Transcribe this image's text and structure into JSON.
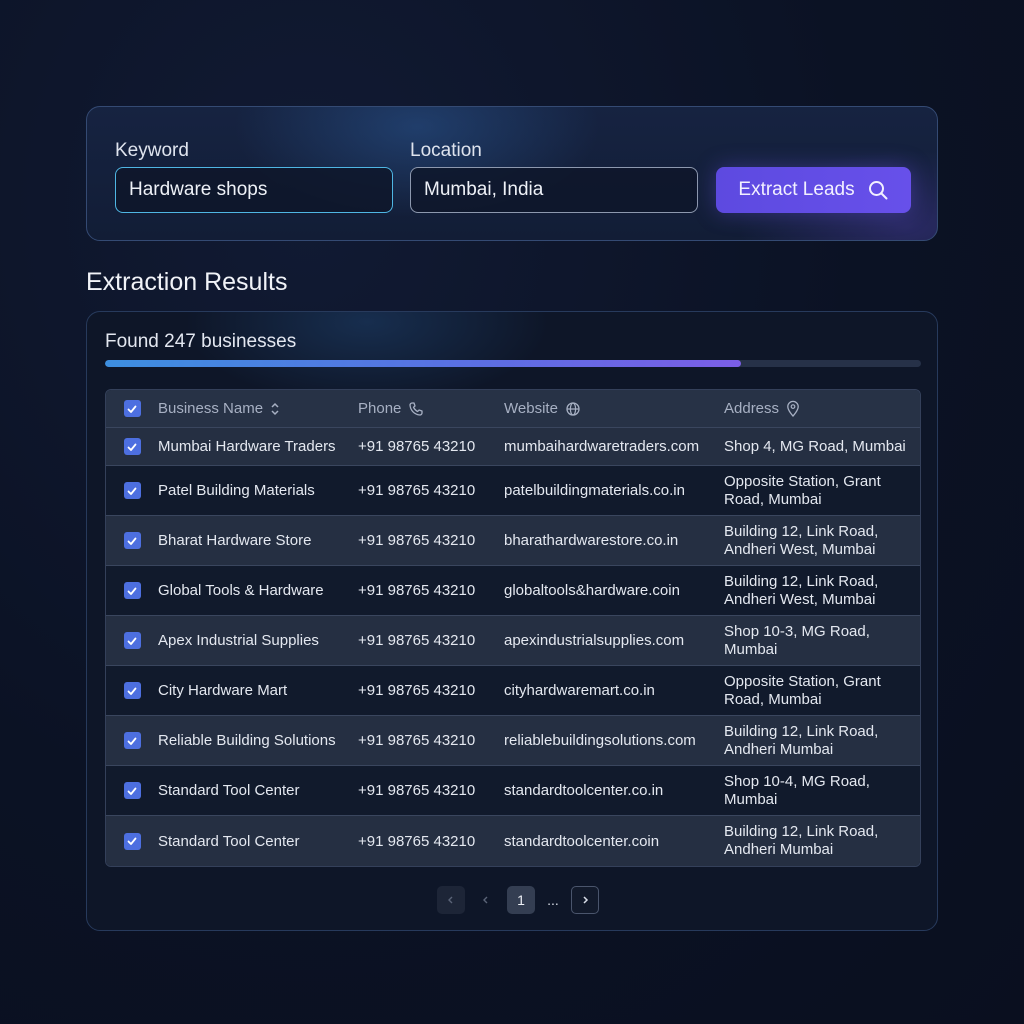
{
  "search": {
    "keyword_label": "Keyword",
    "keyword_value": "Hardware shops",
    "location_label": "Location",
    "location_value": "Mumbai, India",
    "extract_label": "Extract Leads",
    "extract_icon": "search-icon"
  },
  "results": {
    "title": "Extraction Results",
    "found_text": "Found 247 businesses",
    "progress_fraction": 0.78,
    "columns": {
      "name": "Business Name",
      "phone": "Phone",
      "website": "Website",
      "address": "Address"
    },
    "column_icons": {
      "name": "sort-icon",
      "phone": "phone-icon",
      "website": "globe-icon",
      "address": "map-pin-icon"
    },
    "rows": [
      {
        "name": "Mumbai Hardware Traders",
        "phone": "+91 98765 43210",
        "website": "mumbaihardwaretraders.com",
        "address_line1": "Shop 4, MG Road, Mumbai",
        "address_line2": "",
        "checked": true
      },
      {
        "name": "Patel Building Materials",
        "phone": "+91 98765 43210",
        "website": "patelbuildingmaterials.co.in",
        "address_line1": "Opposite Station, Grant",
        "address_line2": "Road, Mumbai",
        "checked": true
      },
      {
        "name": "Bharat Hardware Store",
        "phone": "+91 98765 43210",
        "website": "bharathardwarestore.co.in",
        "address_line1": "Building 12, Link Road,",
        "address_line2": "Andheri West, Mumbai",
        "checked": true
      },
      {
        "name": "Global Tools & Hardware",
        "phone": "+91 98765 43210",
        "website": "globaltools&hardware.coin",
        "address_line1": "Building 12, Link Road,",
        "address_line2": "Andheri West, Mumbai",
        "checked": true
      },
      {
        "name": "Apex Industrial Supplies",
        "phone": "+91 98765 43210",
        "website": "apexindustrialsupplies.com",
        "address_line1": "Shop 10-3, MG Road,",
        "address_line2": "Mumbai",
        "checked": true
      },
      {
        "name": "City Hardware Mart",
        "phone": "+91 98765 43210",
        "website": "cityhardwaremart.co.in",
        "address_line1": "Opposite Station, Grant",
        "address_line2": "Road, Mumbai",
        "checked": true
      },
      {
        "name": "Reliable Building Solutions",
        "phone": "+91 98765 43210",
        "website": "reliablebuildingsolutions.com",
        "address_line1": "Building 12, Link Road,",
        "address_line2": "Andheri Mumbai",
        "checked": true
      },
      {
        "name": "Standard Tool Center",
        "phone": "+91 98765 43210",
        "website": "standardtoolcenter.co.in",
        "address_line1": "Shop 10-4, MG Road,",
        "address_line2": "Mumbai",
        "checked": true
      },
      {
        "name": "Standard Tool Center",
        "phone": "+91 98765 43210",
        "website": "standardtoolcenter.coin",
        "address_line1": "Building 12, Link Road,",
        "address_line2": "Andheri Mumbai",
        "checked": true
      }
    ]
  },
  "pagination": {
    "current_page": "1",
    "ellipsis": "...",
    "prev_icon": "chevron-left-icon",
    "next_icon": "chevron-right-icon"
  },
  "colors": {
    "accent": "#6750ea",
    "checkbox": "#4d6fe0",
    "input_focus": "#4fb6e3"
  }
}
